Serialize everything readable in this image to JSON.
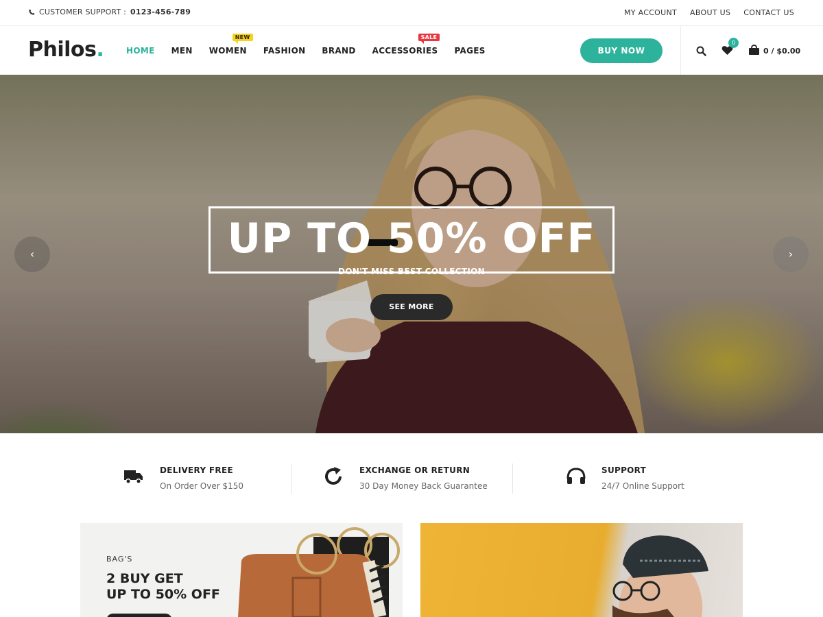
{
  "topbar": {
    "support_label": "CUSTOMER SUPPORT :",
    "support_phone": "0123-456-789",
    "links": [
      "MY ACCOUNT",
      "ABOUT US",
      "CONTACT US"
    ]
  },
  "header": {
    "logo_text": "Philos",
    "logo_dot": ".",
    "nav": [
      {
        "label": "HOME",
        "active": true
      },
      {
        "label": "MEN"
      },
      {
        "label": "WOMEN",
        "badge": "NEW"
      },
      {
        "label": "FASHION"
      },
      {
        "label": "BRAND"
      },
      {
        "label": "ACCESSORIES",
        "badge": "SALE"
      },
      {
        "label": "PAGES"
      }
    ],
    "buy_now": "BUY NOW",
    "wishlist_count": "0",
    "cart_summary": "0 / $0.00",
    "icons": [
      "search-icon",
      "heart-icon",
      "cart-icon"
    ]
  },
  "hero": {
    "title": "UP TO 50% OFF",
    "subtitle": "DON'T MISS BEST COLLECTION",
    "button": "SEE MORE",
    "prev": "‹",
    "next": "›"
  },
  "features": [
    {
      "icon": "truck-icon",
      "title": "DELIVERY FREE",
      "desc": "On Order Over $150"
    },
    {
      "icon": "refresh-icon",
      "title": "EXCHANGE OR RETURN",
      "desc": "30 Day Money Back Guarantee"
    },
    {
      "icon": "headphones-icon",
      "title": "SUPPORT",
      "desc": "24/7 Online Support"
    }
  ],
  "banners": {
    "bags": {
      "category": "BAG'S",
      "title_line1": "2 BUY GET",
      "title_line2": "UP TO 50% OFF"
    }
  },
  "colors": {
    "accent": "#2db39c",
    "new_badge": "#f7d21c",
    "sale_badge": "#e8373e",
    "dark": "#222222"
  }
}
